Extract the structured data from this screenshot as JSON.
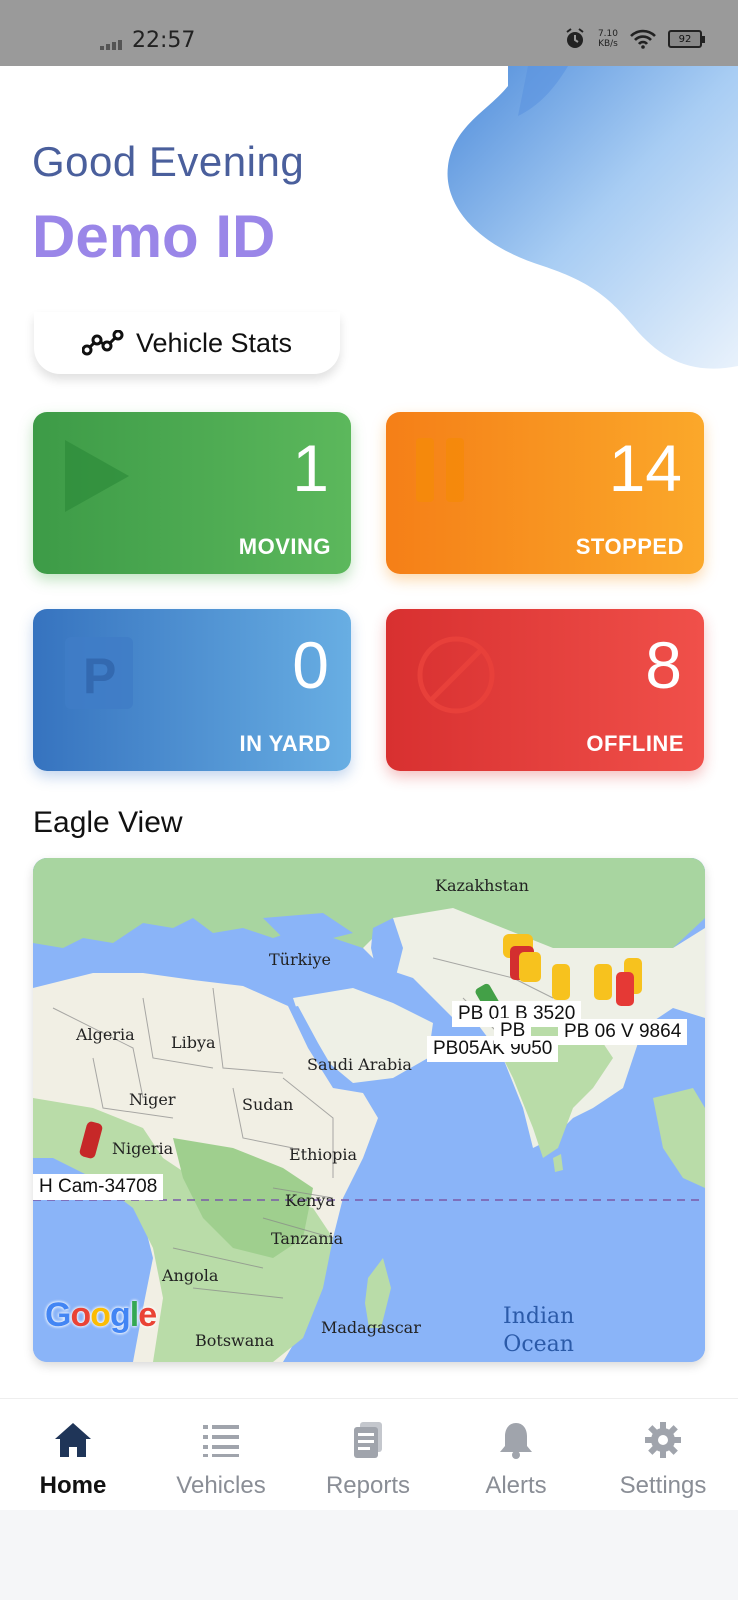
{
  "status_bar": {
    "time": "22:57",
    "net_speed_top": "7.10",
    "net_speed_bottom": "KB/s",
    "battery": "92"
  },
  "header": {
    "greeting": "Good Evening",
    "user": "Demo ID",
    "stats_button": "Vehicle Stats"
  },
  "cards": [
    {
      "count": "1",
      "label": "MOVING",
      "color": "#4caf50",
      "icon": "play-icon"
    },
    {
      "count": "14",
      "label": "STOPPED",
      "color": "#f7931e",
      "icon": "pause-icon"
    },
    {
      "count": "0",
      "label": "IN YARD",
      "color": "#4a90d9",
      "icon": "parking-icon"
    },
    {
      "count": "8",
      "label": "OFFLINE",
      "color": "#e53935",
      "icon": "no-entry-icon"
    }
  ],
  "eagle_view": {
    "title": "Eagle View",
    "places": [
      "Kazakhstan",
      "Türkiye",
      "Algeria",
      "Libya",
      "Saudi Arabia",
      "Niger",
      "Sudan",
      "Nigeria",
      "Ethiopia",
      "Kenya",
      "Tanzania",
      "Angola",
      "Madagascar",
      "Botswana"
    ],
    "ocean": [
      "Indian",
      "Ocean"
    ],
    "plates": [
      "PB 01 B 3520",
      "PB05AK 9050",
      "PB 06 V 9864",
      "PB",
      "H Cam-34708"
    ],
    "google_logo": "Google"
  },
  "nav": [
    {
      "label": "Home",
      "icon": "home-icon",
      "active": true
    },
    {
      "label": "Vehicles",
      "icon": "list-icon",
      "active": false
    },
    {
      "label": "Reports",
      "icon": "reports-icon",
      "active": false
    },
    {
      "label": "Alerts",
      "icon": "bell-icon",
      "active": false
    },
    {
      "label": "Settings",
      "icon": "gear-icon",
      "active": false
    }
  ]
}
